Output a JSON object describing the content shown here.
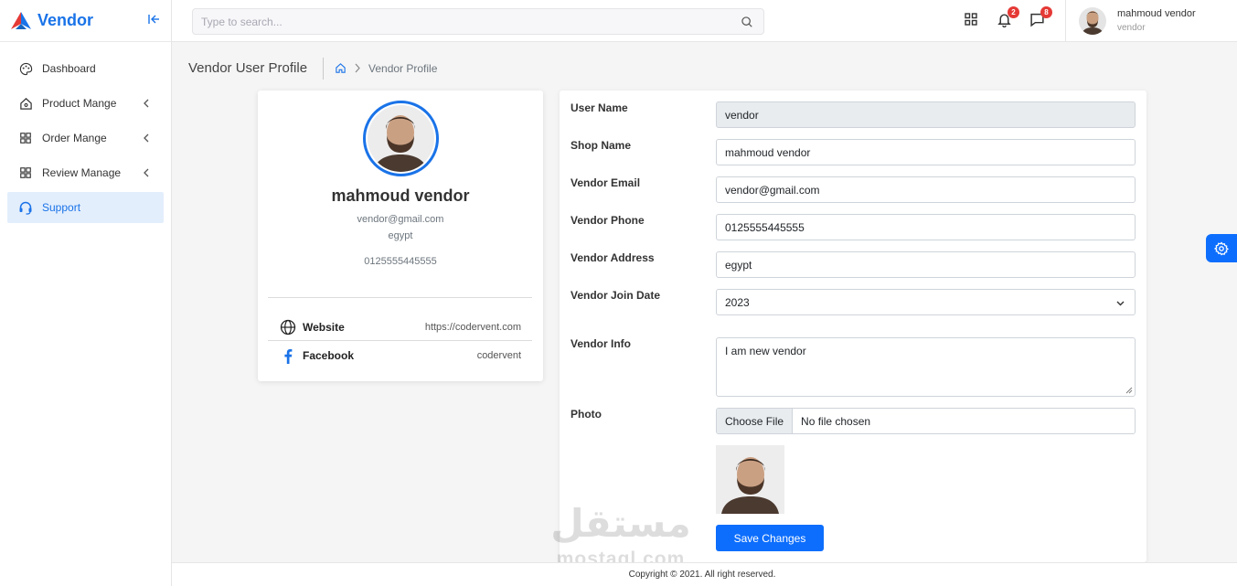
{
  "brand": {
    "name": "Vendor",
    "accent": "#1a73e8"
  },
  "sidebar": {
    "items": [
      {
        "label": "Dashboard",
        "icon": "palette-icon",
        "expandable": false,
        "active": false
      },
      {
        "label": "Product Mange",
        "icon": "home-icon",
        "expandable": true,
        "active": false
      },
      {
        "label": "Order Mange",
        "icon": "grid-icon",
        "expandable": true,
        "active": false
      },
      {
        "label": "Review Manage",
        "icon": "grid-icon",
        "expandable": true,
        "active": false
      },
      {
        "label": "Support",
        "icon": "headset-icon",
        "expandable": false,
        "active": true
      }
    ]
  },
  "topbar": {
    "search_placeholder": "Type to search...",
    "notifications_count": "2",
    "messages_count": "8",
    "user": {
      "name": "mahmoud vendor",
      "role": "vendor"
    }
  },
  "page": {
    "title": "Vendor User Profile",
    "breadcrumb": "Vendor Profile"
  },
  "profile": {
    "name": "mahmoud vendor",
    "email": "vendor@gmail.com",
    "country": "egypt",
    "phone": "0125555445555",
    "links": [
      {
        "label": "Website",
        "value": "https://codervent.com",
        "icon": "globe-icon"
      },
      {
        "label": "Facebook",
        "value": "codervent",
        "icon": "facebook-icon"
      }
    ]
  },
  "form": {
    "username_label": "User Name",
    "username_value": "vendor",
    "shopname_label": "Shop Name",
    "shopname_value": "mahmoud vendor",
    "email_label": "Vendor Email",
    "email_value": "vendor@gmail.com",
    "phone_label": "Vendor Phone",
    "phone_value": "0125555445555",
    "address_label": "Vendor Address",
    "address_value": "egypt",
    "joindate_label": "Vendor Join Date",
    "joindate_value": "2023",
    "info_label": "Vendor Info",
    "info_value": "I am new vendor",
    "photo_label": "Photo",
    "choose_file": "Choose File",
    "no_file": "No file chosen",
    "save_label": "Save Changes"
  },
  "footer": {
    "copyright": "Copyright © 2021. All right reserved."
  },
  "watermark": {
    "arabic": "مستقل",
    "latin": "mostaql.com"
  },
  "colors": {
    "primary": "#0d6efd",
    "badge": "#e53935",
    "sidebar_active_bg": "#e3eefc"
  }
}
